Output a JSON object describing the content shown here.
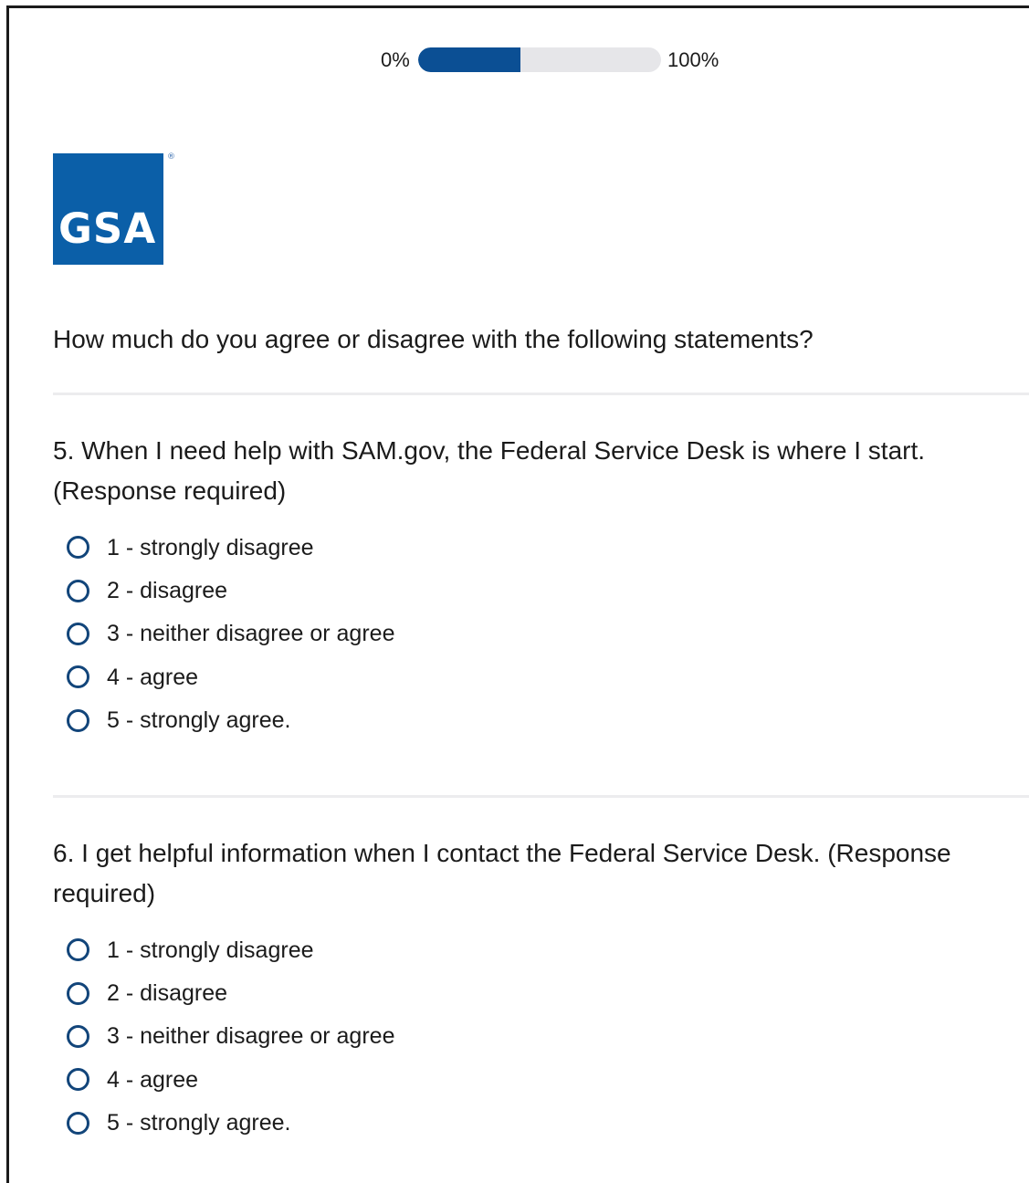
{
  "progress": {
    "min_label": "0%",
    "max_label": "100%",
    "percent": 42,
    "fill_color": "#0b4f94",
    "track_color": "#e6e6e9"
  },
  "logo": {
    "text": "GSA",
    "registered_mark": "®",
    "background_color": "#0b5fa8"
  },
  "intro": "How much do you agree or disagree with the following statements?",
  "questions": [
    {
      "text": "5. When I need help with SAM.gov, the Federal Service Desk is where I start. (Response required)",
      "options": [
        "1 - strongly disagree",
        "2 - disagree",
        "3 - neither disagree or agree",
        "4 - agree",
        "5 - strongly agree."
      ]
    },
    {
      "text": "6. I get helpful information when I contact the Federal Service Desk. (Response required)",
      "options": [
        "1 - strongly disagree",
        "2 - disagree",
        "3 - neither disagree or agree",
        "4 - agree",
        "5 - strongly agree."
      ]
    }
  ]
}
